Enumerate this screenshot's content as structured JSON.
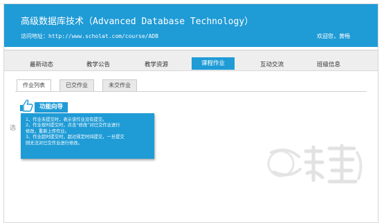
{
  "header": {
    "title": "高级数据库技术（Advanced Database Technology）",
    "url_line": "访问地址：http://www.scholat.com/course/ADB",
    "welcome": "欢迎您，黄畅"
  },
  "nav": {
    "items": [
      {
        "label": "最新动态"
      },
      {
        "label": "教学公告"
      },
      {
        "label": "教学资源"
      },
      {
        "label": "课程作业"
      },
      {
        "label": "互动交流"
      },
      {
        "label": "班级信息"
      }
    ],
    "active": "课程作业"
  },
  "subtabs": [
    {
      "label": "作业列表"
    },
    {
      "label": "已交作业"
    },
    {
      "label": "未交作业"
    }
  ],
  "guide": {
    "title": "功能向导",
    "lines": [
      "1、作业未提交时，表示该作业没有提交。",
      "2、作业按时提交时，点击“修改”对已交作业进行",
      "修改，重新上传作业。",
      "3、作业超时提交时，超过规定时间提交，一旦提交",
      "则无法对已交作业进行修改。"
    ]
  },
  "misc": {
    "ghost_char": "选"
  },
  "colors": {
    "accent": "#1f9bd6",
    "nav_bg": "#eeeeee"
  }
}
